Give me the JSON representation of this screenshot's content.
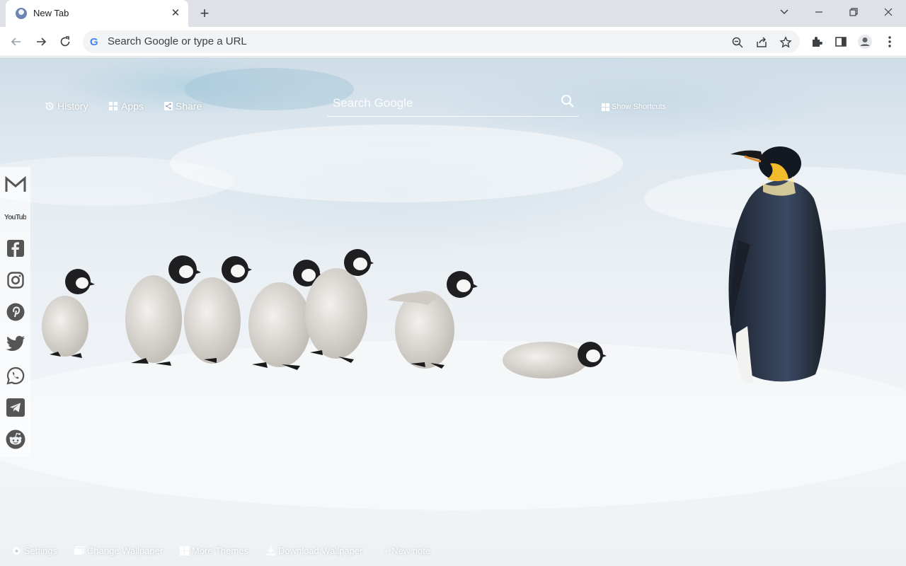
{
  "browser": {
    "tab_title": "New Tab",
    "omnibox_placeholder": "Search Google or type a URL"
  },
  "top_links": {
    "history": "History",
    "apps": "Apps",
    "share": "Share"
  },
  "search": {
    "placeholder": "Search Google"
  },
  "shortcuts_label": "Show Shortcuts",
  "social": [
    "gmail-icon",
    "youtube-icon",
    "facebook-icon",
    "instagram-icon",
    "pinterest-icon",
    "twitter-icon",
    "whatsapp-icon",
    "telegram-icon",
    "reddit-icon"
  ],
  "youtube_label": "YouTube",
  "footer": {
    "settings": "Settings",
    "change_wallpaper": "Change Wallpaper",
    "more_themes": "More Themes",
    "download_wallpaper": "Download Wallpaper",
    "new_note": "+ New note"
  }
}
